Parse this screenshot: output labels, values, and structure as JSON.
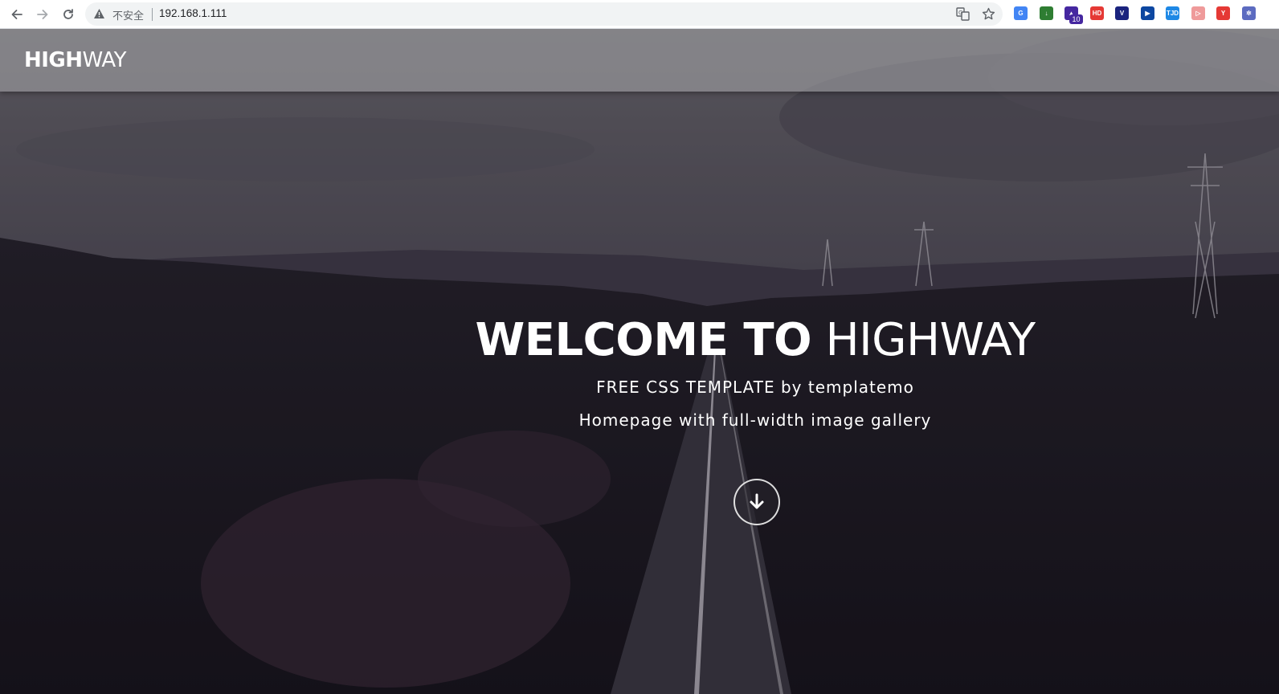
{
  "browser": {
    "security_label": "不安全",
    "url": "192.168.1.111",
    "extensions": [
      {
        "name": "translate-ext-icon",
        "color": "#4285f4",
        "label": "G"
      },
      {
        "name": "download-ext-icon",
        "color": "#2e7d32",
        "label": "↓"
      },
      {
        "name": "graduation-ext-icon",
        "color": "#4527a0",
        "label": "▲",
        "badge": "10"
      },
      {
        "name": "bilibili-ext-icon",
        "color": "#e53935",
        "label": "HD"
      },
      {
        "name": "vue-ext-icon",
        "color": "#1a237e",
        "label": "V"
      },
      {
        "name": "play-ext-icon",
        "color": "#0d47a1",
        "label": "▶"
      },
      {
        "name": "tjd-ext-icon",
        "color": "#1e88e5",
        "label": "TJD"
      },
      {
        "name": "arrow-ext-icon",
        "color": "#ef9a9a",
        "label": "▷"
      },
      {
        "name": "yandex-ext-icon",
        "color": "#e53935",
        "label": "Y"
      },
      {
        "name": "settings-ext-icon",
        "color": "#5c6bc0",
        "label": "✲"
      }
    ]
  },
  "site": {
    "logo_bold": "HIGH",
    "logo_light": "WAY"
  },
  "hero": {
    "title_bold": "WELCOME TO",
    "title_light": "HIGHWAY",
    "subtitle_1": "FREE CSS TEMPLATE by templatemo",
    "subtitle_2": "Homepage with full-width image gallery",
    "scroll_icon": "arrow-down-icon"
  }
}
